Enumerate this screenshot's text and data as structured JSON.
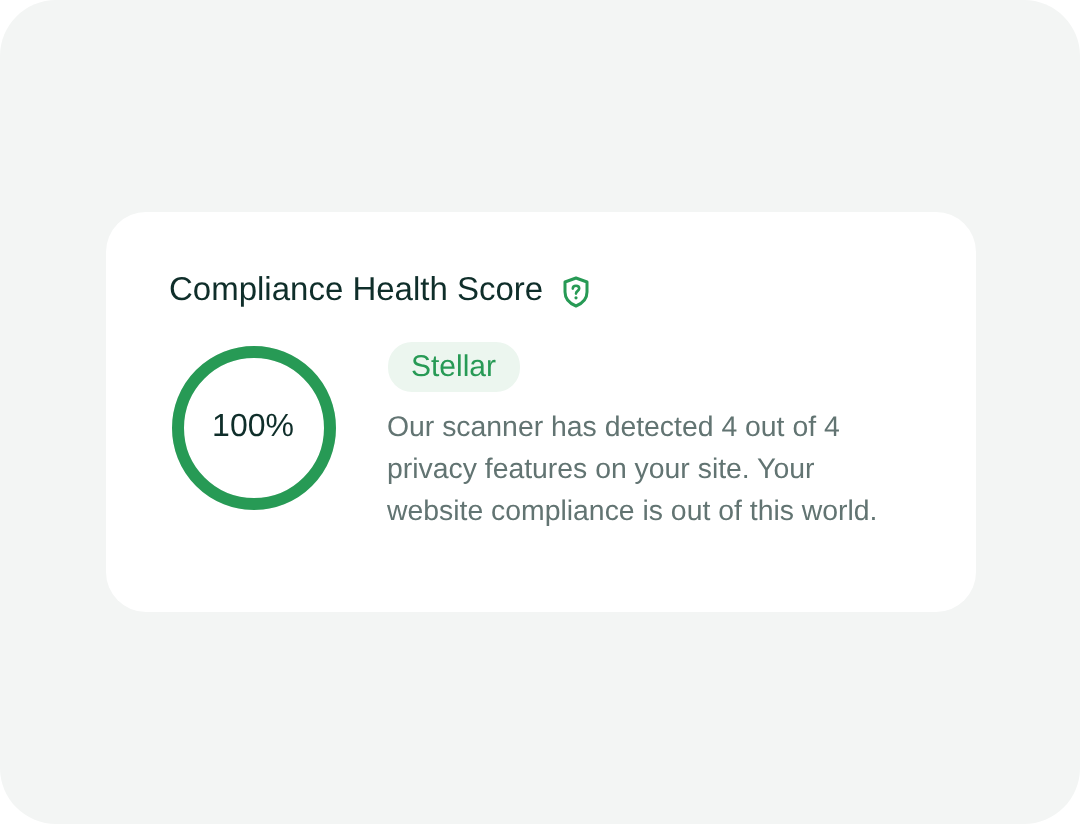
{
  "card": {
    "title": "Compliance Health Score",
    "score": {
      "reading": "100%",
      "level": 1
    },
    "rating": "Stellar",
    "description": "Our scanner has detected 4 out of 4 privacy features on your site. Your website compliance is out of this world."
  }
}
